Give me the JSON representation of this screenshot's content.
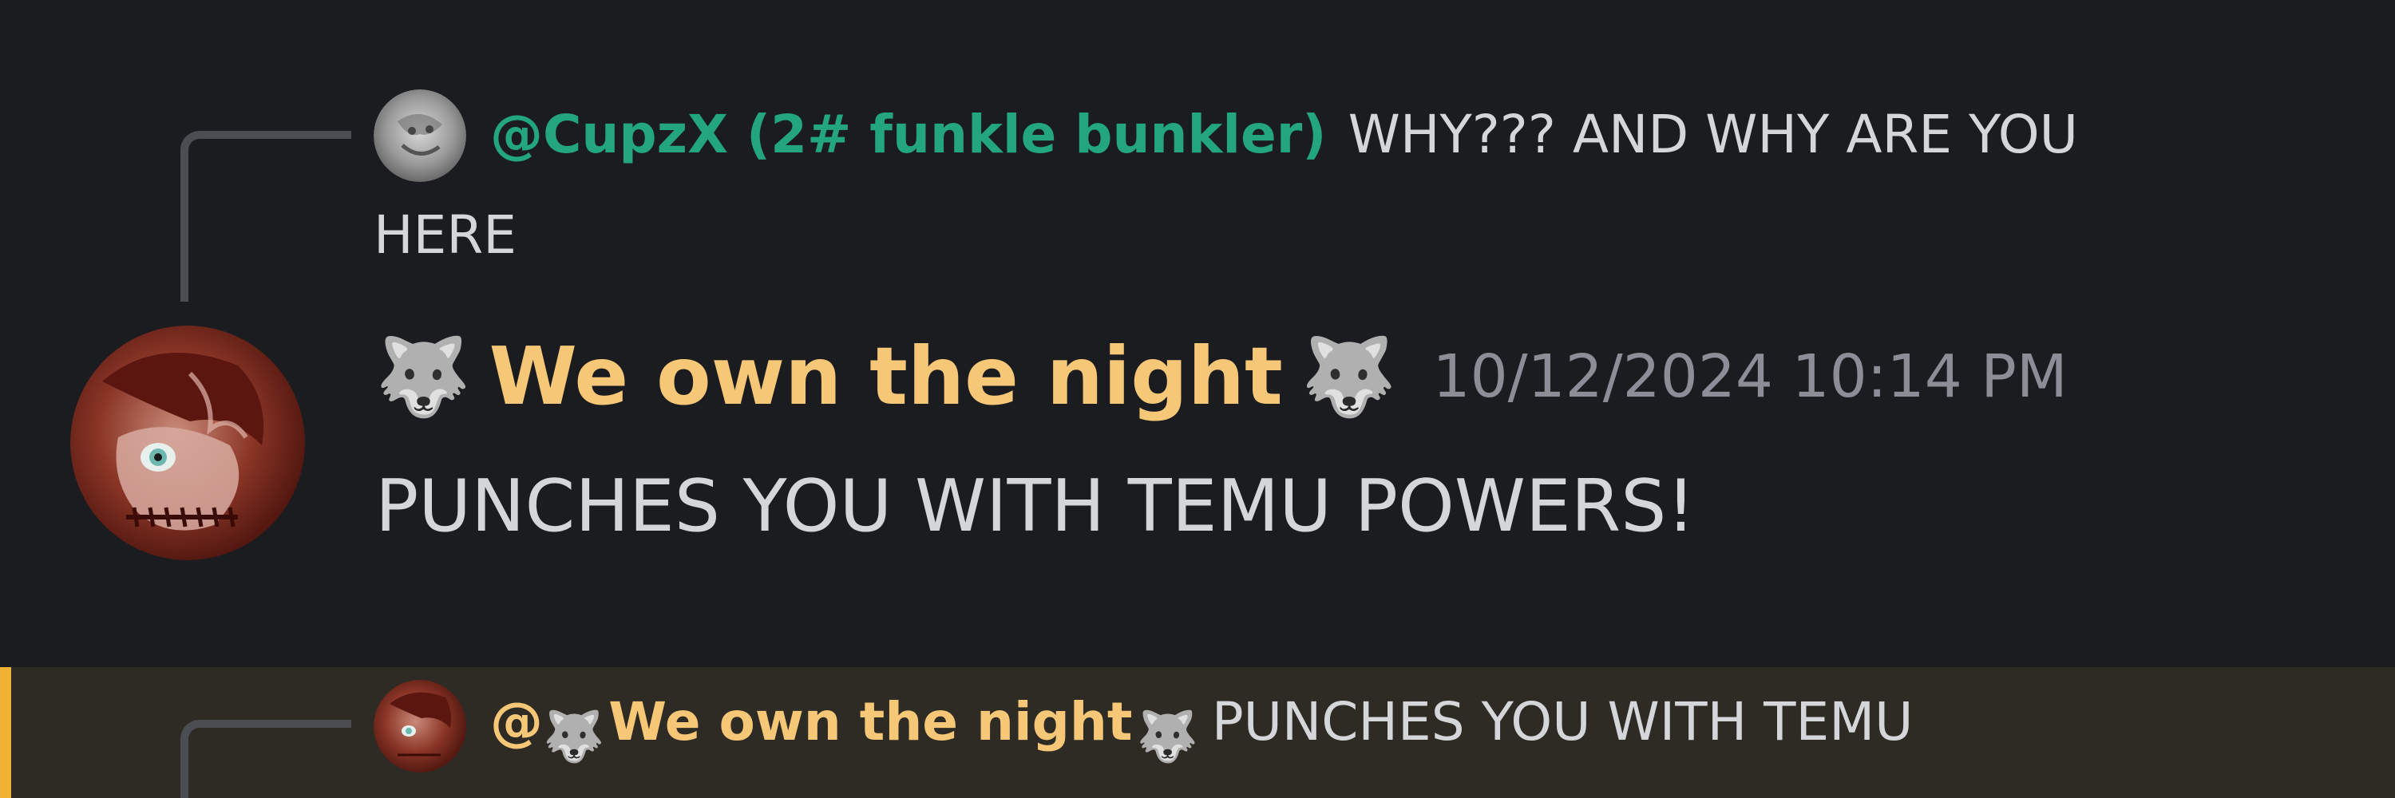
{
  "reply_top": {
    "author": "@CupzX (2# funkle bunkler)",
    "author_color": "#23a57f",
    "text_line1": "WHY??? AND WHY ARE YOU",
    "text_line2": "HERE"
  },
  "message": {
    "author_emoji_left": "🐺",
    "author": "We own the night",
    "author_emoji_right": "🐺",
    "author_color": "#f6c777",
    "timestamp": "10/12/2024 10:14 PM",
    "text": "PUNCHES YOU WITH TEMU POWERS!"
  },
  "reply_bottom": {
    "author_prefix": "@",
    "author_emoji_left": "🐺",
    "author": "We own the night",
    "author_emoji_right": "🐺",
    "author_color": "#f6c777",
    "text": "PUNCHES YOU WITH TEMU",
    "highlight_color": "#f0b232"
  },
  "colors": {
    "background": "#1b1c20",
    "text": "#d4d6da",
    "timestamp": "#8b8e96",
    "connector": "#4b4d53",
    "mention_background": "#2e2b24"
  }
}
